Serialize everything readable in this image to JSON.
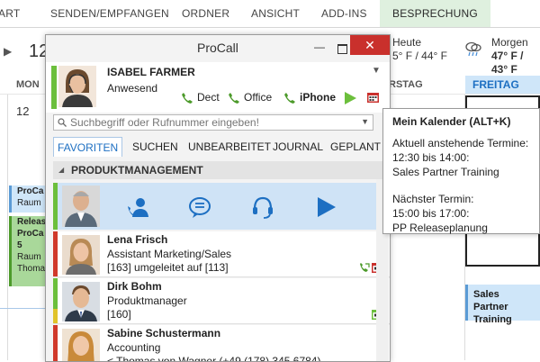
{
  "ribbon": {
    "tabs": [
      "ART",
      "SENDEN/EMPFANGEN",
      "ORDNER",
      "ANSICHT",
      "ADD-INS",
      "BESPRECHUNG"
    ]
  },
  "weather": {
    "today_label": "Heute",
    "today_temp": "5° F / 44° F",
    "tomorrow_label": "Morgen",
    "tomorrow_temp": "47° F / 43° F"
  },
  "calendar": {
    "nav": "▶",
    "year_fragment": "12",
    "days": [
      "MON",
      "RSTAG",
      "FREITAG"
    ],
    "day_number": "12",
    "appointments": [
      {
        "lines": [
          "ProCa",
          "Raum"
        ]
      },
      {
        "lines": [
          "Releas",
          "ProCa",
          "5",
          "Raum",
          "Thoma"
        ]
      }
    ],
    "sales_partner": "Sales Partner Training"
  },
  "procall": {
    "title": "ProCall",
    "window": {
      "min": "—",
      "close": "✕"
    },
    "me": {
      "name": "ISABEL FARMER",
      "status": "Anwesend",
      "status_color": "#6cbf3c",
      "devices": [
        "Dect",
        "Office",
        "iPhone"
      ]
    },
    "search": {
      "placeholder": "Suchbegriff oder Rufnummer eingeben!"
    },
    "tabs": [
      "FAVORITEN",
      "SUCHEN",
      "UNBEARBEITET",
      "JOURNAL",
      "GEPLANT"
    ],
    "group": "PRODUKTMANAGEMENT",
    "contacts": [
      {
        "name": "Lena Frisch",
        "title": "Assistant Marketing/Sales",
        "info": "[163] umgeleitet auf [113]",
        "status_color": "#d0392b"
      },
      {
        "name": "Dirk Bohm",
        "title": "Produktmanager",
        "info": "[160]",
        "status_color": "#6cbf3c"
      },
      {
        "name": "Sabine Schustermann",
        "title": "Accounting",
        "info": "< Thomas von Wagner (+49 (178) 345 6784)",
        "status_color": "#d0392b"
      }
    ]
  },
  "tooltip": {
    "title": "Mein Kalender (ALT+K)",
    "current_label": "Aktuell anstehende Termine:",
    "current_time": "12:30 bis 14:00:",
    "current_event": "Sales Partner Training",
    "next_label": "Nächster Termin:",
    "next_time": "15:00 bis 17:00:",
    "next_event": "PP Releaseplanung"
  },
  "colors": {
    "accent": "#1d6fc2",
    "online": "#6cbf3c",
    "busy": "#d0392b",
    "close": "#c9302c"
  }
}
